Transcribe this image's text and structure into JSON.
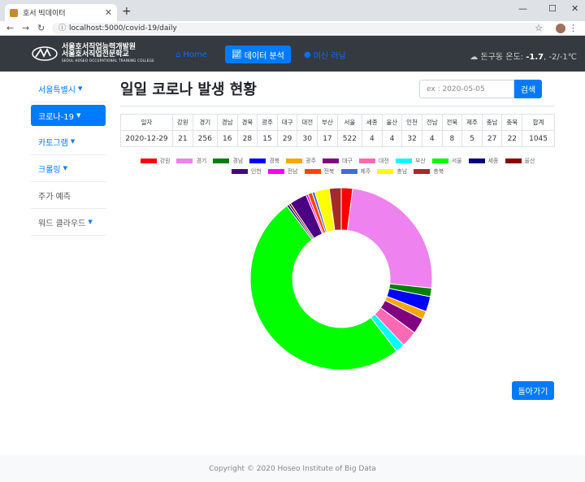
{
  "browser": {
    "tab_title": "호서 빅데이터",
    "url": "localhost:5000/covid-19/daily"
  },
  "navbar": {
    "logo_line1": "서울호서직업능력개발원",
    "logo_line2": "서울호서직업전문학교",
    "logo_line3": "SEOUL HOSEO OCCUPATIONAL TRAINING COLLEGE",
    "links": [
      {
        "label": "Home",
        "icon": "home-icon"
      },
      {
        "label": "데이터 분석",
        "icon": "chart-line-icon"
      },
      {
        "label": "머신 러닝",
        "icon": "globe-icon"
      }
    ],
    "weather_prefix": "돈구동 온도: ",
    "weather_temp": "-1.7",
    "weather_range": ", -2/-1℃"
  },
  "sidebar": {
    "items": [
      {
        "label": "서울특별시",
        "dropdown": true
      },
      {
        "label": "코로나-19",
        "dropdown": true
      },
      {
        "label": "카토그램",
        "dropdown": true
      },
      {
        "label": "크롤링",
        "dropdown": true
      },
      {
        "label": "주가 예측",
        "dropdown": false
      },
      {
        "label": "워드 클라우드",
        "dropdown": true
      }
    ]
  },
  "main": {
    "title": "일일 코로나 발생 현황",
    "search_placeholder": "ex : 2020-05-05",
    "search_button": "검색",
    "back_button": "돌아가기"
  },
  "table": {
    "headers": [
      "일자",
      "강원",
      "경기",
      "경남",
      "경북",
      "광주",
      "대구",
      "대전",
      "부산",
      "서울",
      "세종",
      "울산",
      "인천",
      "전남",
      "전북",
      "제주",
      "충남",
      "충북",
      "합계"
    ],
    "row": [
      "2020-12-29",
      "21",
      "256",
      "16",
      "28",
      "15",
      "29",
      "30",
      "17",
      "522",
      "4",
      "4",
      "32",
      "4",
      "8",
      "5",
      "27",
      "22",
      "1045"
    ]
  },
  "chart_data": {
    "type": "pie",
    "donut": true,
    "categories": [
      "강원",
      "경기",
      "경남",
      "경북",
      "광주",
      "대구",
      "대전",
      "부산",
      "서울",
      "세종",
      "울산",
      "인천",
      "전남",
      "전북",
      "제주",
      "충남",
      "충북"
    ],
    "values": [
      21,
      256,
      16,
      28,
      15,
      29,
      30,
      17,
      522,
      4,
      4,
      32,
      4,
      8,
      5,
      27,
      22
    ],
    "colors": [
      "#ff0000",
      "#ee82ee",
      "#008000",
      "#0000ff",
      "#ffa500",
      "#800080",
      "#ff69b4",
      "#00ffff",
      "#00ff00",
      "#000080",
      "#8b0000",
      "#4b0082",
      "#ff00ff",
      "#ff4500",
      "#4169e1",
      "#ffff00",
      "#a52a2a"
    ]
  },
  "footer": {
    "copyright": "Copyright © 2020 Hoseo Institute of Big Data"
  }
}
